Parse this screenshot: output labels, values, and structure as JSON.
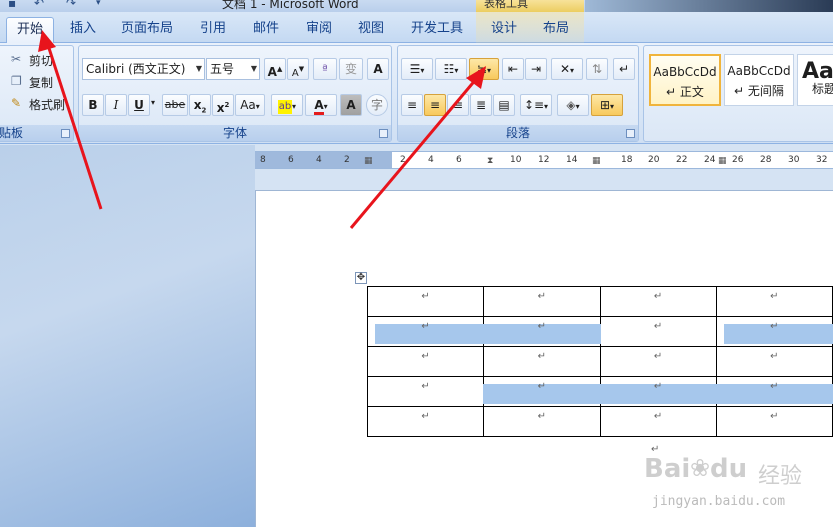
{
  "title_bar": {
    "document_title": "文档 1 - Microsoft Word",
    "contextual_label": "表格工具"
  },
  "tabs": [
    {
      "label": "开始",
      "active": true
    },
    {
      "label": "插入"
    },
    {
      "label": "页面布局"
    },
    {
      "label": "引用"
    },
    {
      "label": "邮件"
    },
    {
      "label": "审阅"
    },
    {
      "label": "视图"
    },
    {
      "label": "开发工具"
    },
    {
      "label": "设计"
    },
    {
      "label": "布局"
    }
  ],
  "clipboard": {
    "cut": "剪切",
    "copy": "复制",
    "format_painter": "格式刷",
    "group_label": "贴板"
  },
  "font": {
    "name": "Calibri (西文正文)",
    "size": "五号",
    "group_label": "字体",
    "grow": "A",
    "shrink": "A",
    "bold": "B",
    "italic": "I",
    "underline": "U",
    "strike": "abe",
    "subscript": "x",
    "superscript": "x",
    "change_case": "Aa",
    "font_color_icon": "A",
    "char_shading": "A",
    "char_border": "A"
  },
  "paragraph": {
    "group_label": "段落"
  },
  "styles": [
    {
      "sample": "AaBbCcDd",
      "name": "正文"
    },
    {
      "sample": "AaBbCcDd",
      "name": "无间隔"
    },
    {
      "sample": "Aa",
      "name": "标题"
    }
  ],
  "ruler": {
    "labels": [
      "8",
      "6",
      "4",
      "2",
      "2",
      "4",
      "6",
      "10",
      "12",
      "14",
      "18",
      "20",
      "22",
      "24",
      "26",
      "28",
      "30",
      "32"
    ]
  },
  "table": {
    "rows": [
      [
        "↵",
        "↵",
        "↵",
        "↵"
      ],
      [
        "↵",
        "↵",
        "↵",
        "↵"
      ],
      [
        "↵",
        "↵",
        "↵",
        "↵"
      ],
      [
        "↵",
        "↵",
        "↵",
        "↵"
      ],
      [
        "↵",
        "↵",
        "↵",
        "↵"
      ]
    ],
    "after_mark": "↵"
  },
  "watermark": {
    "brand": "Bai",
    "brand2": "经验",
    "url": "jingyan.baidu.com"
  },
  "colors": {
    "selection": "#a6c7ec",
    "arrow": "#e8141c",
    "active_button": "#f8c95c"
  }
}
